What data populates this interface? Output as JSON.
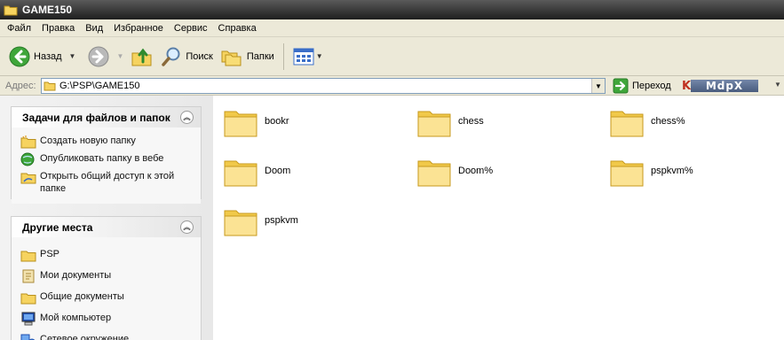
{
  "window": {
    "title": "GAME150"
  },
  "menu": [
    "Файл",
    "Правка",
    "Вид",
    "Избранное",
    "Сервис",
    "Справка"
  ],
  "toolbar": {
    "back_label": "Назад",
    "search_label": "Поиск",
    "folders_label": "Папки"
  },
  "address": {
    "label": "Адрес:",
    "path": "G:\\PSP\\GAME150",
    "go_label": "Переход",
    "addon_label": "MdpX"
  },
  "tasks_panel": {
    "title": "Задачи для файлов и папок",
    "items": [
      {
        "label": "Создать новую папку",
        "icon": "new-folder-icon"
      },
      {
        "label": "Опубликовать папку в вебе",
        "icon": "publish-web-icon"
      },
      {
        "label": "Открыть общий доступ к этой папке",
        "icon": "share-folder-icon"
      }
    ]
  },
  "places_panel": {
    "title": "Другие места",
    "items": [
      {
        "label": "PSP",
        "icon": "folder-icon"
      },
      {
        "label": "Мои документы",
        "icon": "my-documents-icon"
      },
      {
        "label": "Общие документы",
        "icon": "folder-icon"
      },
      {
        "label": "Мой компьютер",
        "icon": "my-computer-icon"
      },
      {
        "label": "Сетевое окружение",
        "icon": "network-icon"
      }
    ]
  },
  "files": [
    {
      "name": "bookr"
    },
    {
      "name": "chess"
    },
    {
      "name": "chess%"
    },
    {
      "name": "Doom"
    },
    {
      "name": "Doom%"
    },
    {
      "name": "pspkvm%"
    },
    {
      "name": "pspkvm"
    }
  ]
}
